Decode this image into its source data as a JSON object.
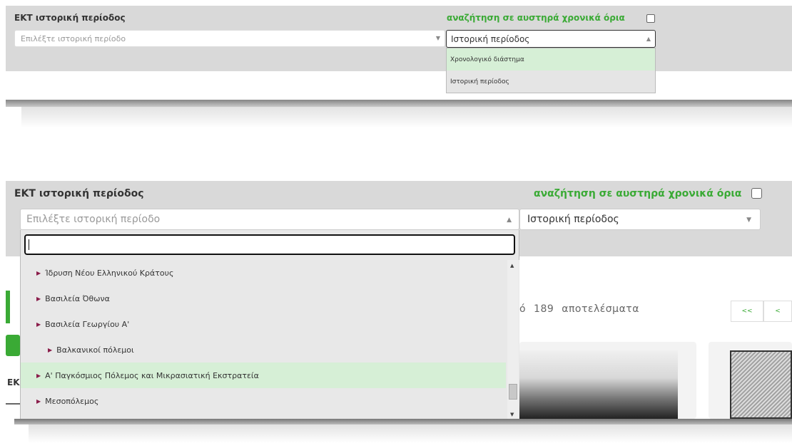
{
  "top_panel": {
    "title": "ΕΚΤ ιστορική περίοδος",
    "strict_label": "αναζήτηση σε αυστηρά χρονικά όρια",
    "period_placeholder": "Επιλέξτε ιστορική περίοδο",
    "mode_selected": "Ιστορική περίοδος",
    "mode_options": [
      "Χρονολογικό διάστημα",
      "Ιστορική περίοδος"
    ]
  },
  "bottom_panel": {
    "title": "ΕΚΤ ιστορική περίοδος",
    "strict_label": "αναζήτηση σε αυστηρά χρονικά όρια",
    "period_placeholder": "Επιλέξτε ιστορική περίοδο",
    "mode_selected": "Ιστορική περίοδος",
    "search_value": "",
    "period_options": [
      "Ίδρυση Νέου Ελληνικού Κράτους",
      "Βασιλεία Όθωνα",
      "Βασιλεία Γεωργίου Α'",
      "Βαλκανικοί πόλεμοι",
      "Α' Παγκόσμιος Πόλεμος και Μικρασιατική Εκστρατεία",
      "Μεσοπόλεμος"
    ],
    "results_prefix": "ό",
    "results_count": "189",
    "results_label": "αποτελέσματα",
    "pager_first": "<<",
    "pager_prev": "<",
    "partial_label": "ΕΚ"
  }
}
